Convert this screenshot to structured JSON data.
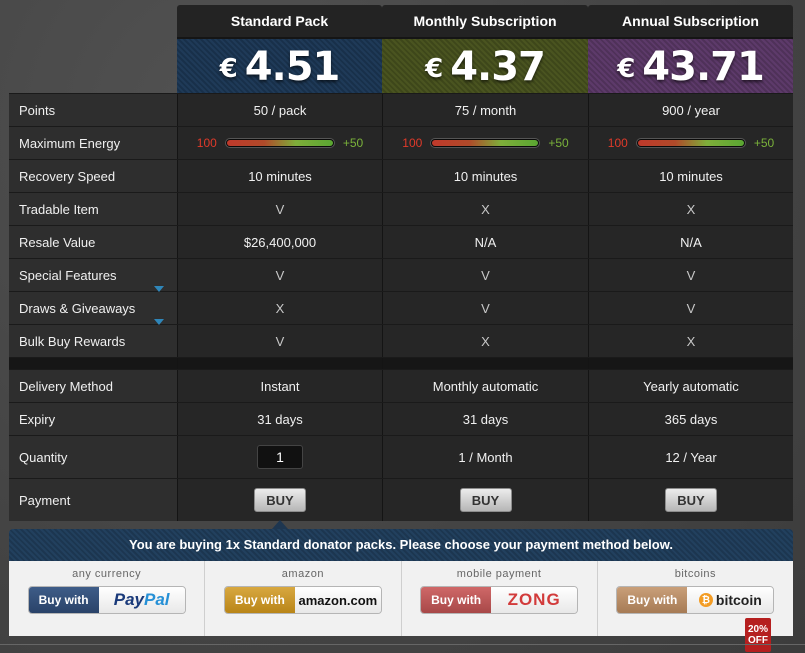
{
  "plans": [
    {
      "name": "Standard Pack",
      "currency": "€",
      "price": "4.51"
    },
    {
      "name": "Monthly Subscription",
      "currency": "€",
      "price": "4.37"
    },
    {
      "name": "Annual Subscription",
      "currency": "€",
      "price": "43.71"
    }
  ],
  "rows": {
    "points": {
      "label": "Points",
      "values": [
        "50 / pack",
        "75 / month",
        "900 / year"
      ]
    },
    "energy": {
      "label": "Maximum Energy",
      "low": "100",
      "high": "+50",
      "fill_fraction": 1.0
    },
    "recovery": {
      "label": "Recovery Speed",
      "values": [
        "10 minutes",
        "10 minutes",
        "10 minutes"
      ]
    },
    "tradable": {
      "label": "Tradable Item",
      "values": [
        "V",
        "X",
        "X"
      ]
    },
    "resale": {
      "label": "Resale Value",
      "values": [
        "$26,400,000",
        "N/A",
        "N/A"
      ]
    },
    "special": {
      "label": "Special Features",
      "values": [
        "V",
        "V",
        "V"
      ]
    },
    "draws": {
      "label": "Draws & Giveaways",
      "values": [
        "X",
        "V",
        "V"
      ]
    },
    "bulk": {
      "label": "Bulk Buy Rewards",
      "values": [
        "V",
        "X",
        "X"
      ]
    },
    "delivery": {
      "label": "Delivery Method",
      "values": [
        "Instant",
        "Monthly automatic",
        "Yearly automatic"
      ]
    },
    "expiry": {
      "label": "Expiry",
      "values": [
        "31 days",
        "31 days",
        "365 days"
      ]
    },
    "quantity": {
      "label": "Quantity",
      "input_value": "1",
      "values": [
        "",
        "1 / Month",
        "12 / Year"
      ]
    },
    "payment": {
      "label": "Payment",
      "button": "BUY"
    }
  },
  "payment_panel": {
    "message": "You are buying 1x Standard donator packs. Please choose your payment method below.",
    "options": [
      {
        "caption": "any currency",
        "buy_with": "Buy with",
        "brand_a": "Pay",
        "brand_b": "Pal"
      },
      {
        "caption": "amazon",
        "buy_with": "Buy with",
        "brand": "amazon.com"
      },
      {
        "caption": "mobile payment",
        "buy_with": "Buy with",
        "brand": "ZONG"
      },
      {
        "caption": "bitcoins",
        "buy_with": "Buy with",
        "brand": "bitcoin",
        "badge": "20% OFF",
        "btc_symbol": "₿"
      }
    ]
  },
  "colors": {
    "standard": "#1f3a58",
    "monthly": "#4a5420",
    "annual": "#5d3a6a"
  }
}
